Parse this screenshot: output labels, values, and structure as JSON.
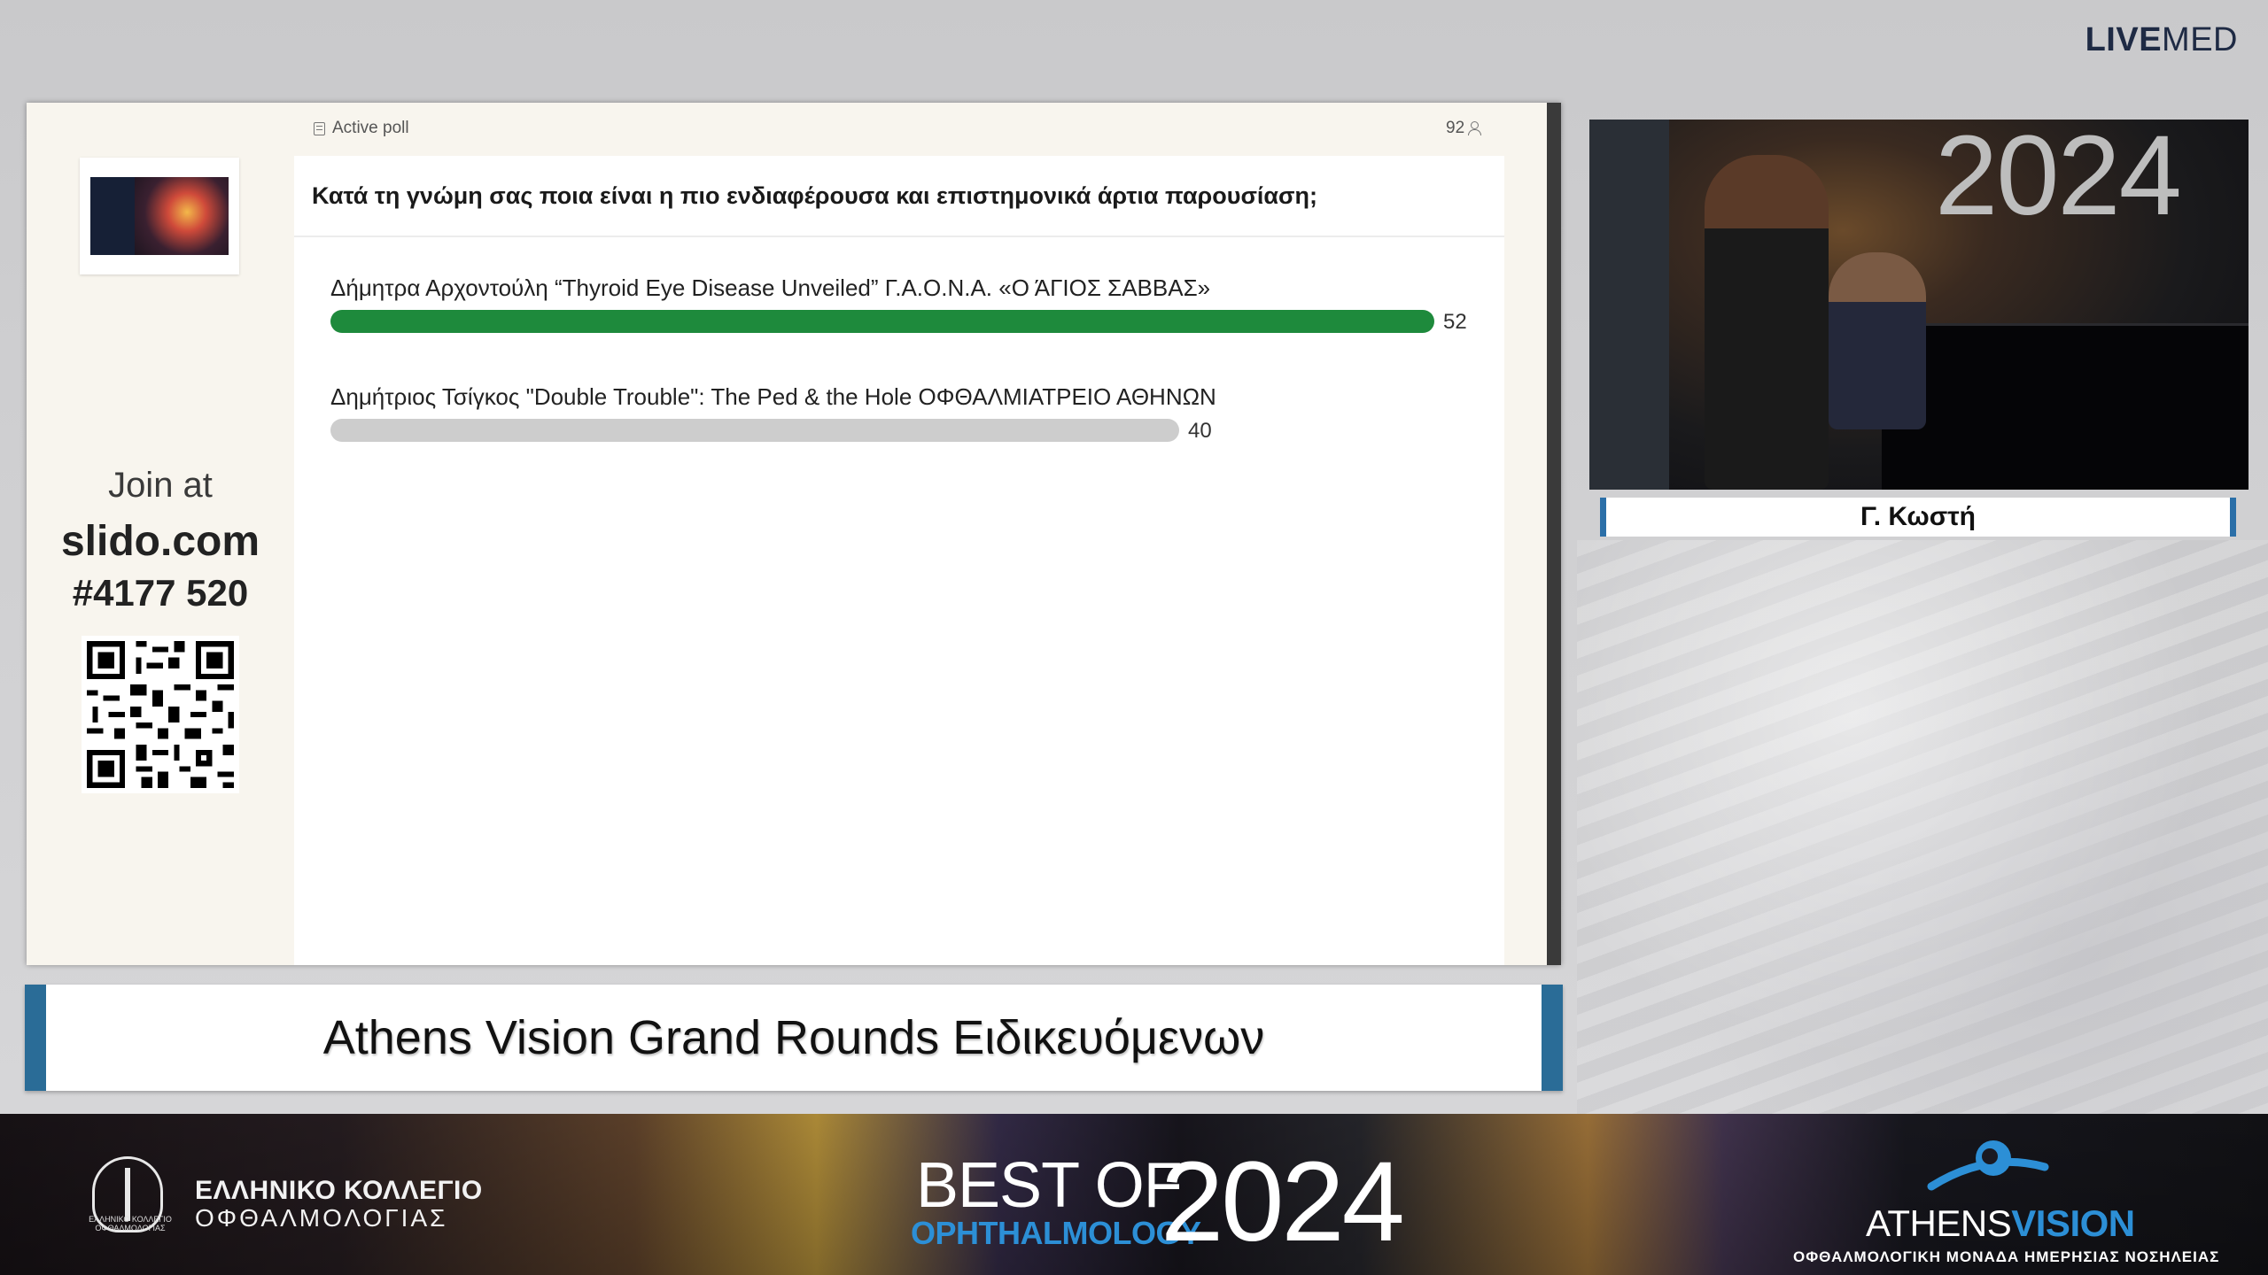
{
  "brand": {
    "live": "LIVE",
    "med": "MED"
  },
  "poll": {
    "status_label": "Active poll",
    "participants": "92",
    "question": "Κατά τη γνώμη σας ποια είναι η πιο ενδιαφέρουσα και επιστημονικά άρτια παρουσίαση;",
    "options": [
      {
        "label": "Δήμητρα Αρχοντούλη “Thyroid Eye Disease Unveiled” Γ.Α.Ο.Ν.Α. «Ο ΆΓΙΟΣ ΣΑΒΒΑΣ»",
        "votes": 52,
        "color": "#1e8a3c"
      },
      {
        "label": "Δημήτριος Τσίγκος \"Double Trouble\": The Ped & the Hole ΟΦΘΑΛΜΙΑΤΡΕΙΟ ΑΘΗΝΩΝ",
        "votes": 40,
        "color": "#cdcdcd"
      }
    ]
  },
  "join": {
    "prefix": "Join at",
    "site": "slido.com",
    "code": "#4177 520"
  },
  "video": {
    "backdrop_year": "2024",
    "speaker_name": "Γ. Κωστή"
  },
  "banner": {
    "title": "Athens Vision Grand Rounds Ειδικευόμενων"
  },
  "footer": {
    "college_line1": "ΕΛΛΗΝΙΚΟ ΚΟΛΛΕΓΙΟ",
    "college_line2": "ΟΦΘΑΛΜΟΛΟΓΙΑΣ",
    "college_small": "ΕΛΛΗΝΙΚΟ ΚΟΛΛΕΓΙΟ ΟΦΘΑΛΜΟΛΟΓΙΑΣ",
    "event_best_of": "BEST OF",
    "event_specialty": "OPHTHALMOLOGY",
    "event_year": "2024",
    "sponsor_athens": "ATHENS",
    "sponsor_vision": "VISION",
    "sponsor_sub": "ΟΦΘΑΛΜΟΛΟΓΙΚΗ ΜΟΝΑΔΑ ΗΜΕΡΗΣΙΑΣ ΝΟΣΗΛΕΙΑΣ"
  },
  "colors": {
    "accent_blue": "#2b6fa8",
    "bar_green": "#1e8a3c",
    "bar_gray": "#cdcdcd"
  }
}
